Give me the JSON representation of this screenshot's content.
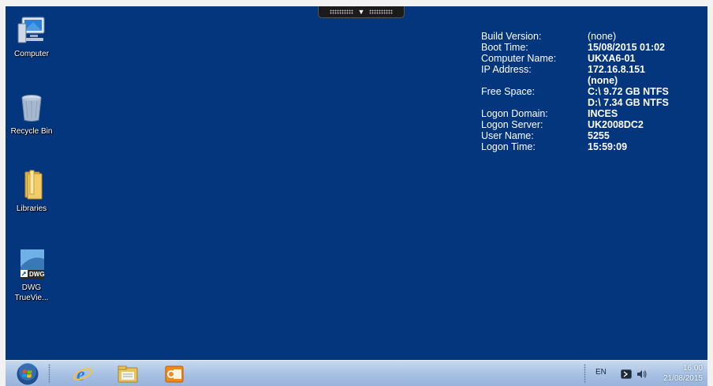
{
  "desktop": {
    "icons": [
      {
        "label": "Computer"
      },
      {
        "label": "Recycle Bin"
      },
      {
        "label": "Libraries"
      },
      {
        "label": "DWG TrueVie...",
        "badge": "DWG"
      }
    ]
  },
  "bginfo": {
    "rows": [
      {
        "key": "Build Version:",
        "value": "(none)"
      },
      {
        "key": "Boot Time:",
        "value": "15/08/2015 01:02"
      },
      {
        "key": "Computer Name:",
        "value": "UKXA6-01"
      },
      {
        "key": "IP Address:",
        "value": "172.16.8.151"
      },
      {
        "key": "",
        "value": "(none)"
      },
      {
        "key": "Free Space:",
        "value": "C:\\ 9.72 GB NTFS"
      },
      {
        "key": "",
        "value": "D:\\ 7.34 GB NTFS"
      },
      {
        "key": "Logon Domain:",
        "value": "INCES"
      },
      {
        "key": "Logon Server:",
        "value": "UK2008DC2"
      },
      {
        "key": "User Name:",
        "value": "5255"
      },
      {
        "key": "Logon Time:",
        "value": "15:59:09"
      }
    ]
  },
  "taskbar": {
    "pinned": [
      "start-button",
      "internet-explorer",
      "file-explorer",
      "outlook"
    ],
    "tray": {
      "language": "EN",
      "time": "16:00",
      "date": "21/08/2015"
    }
  },
  "colors": {
    "desktop": "#04367e",
    "taskbar": "#a9c2e4"
  }
}
